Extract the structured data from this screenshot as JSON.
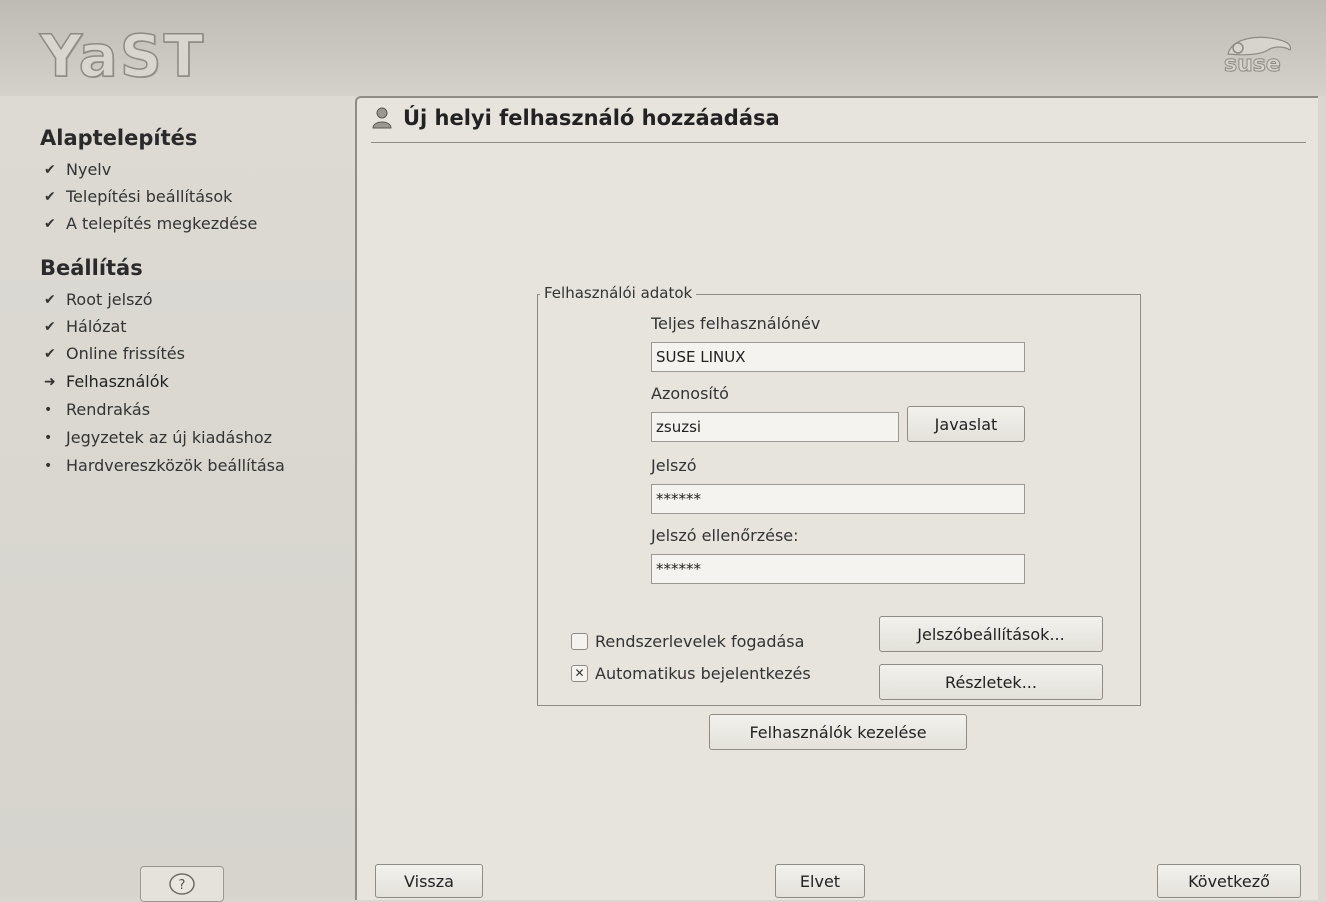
{
  "header": {
    "logo_text": "YaST",
    "brand_text": "suse"
  },
  "sidebar": {
    "sections": [
      {
        "title": "Alaptelepítés",
        "items": [
          {
            "status": "done",
            "label": "Nyelv"
          },
          {
            "status": "done",
            "label": "Telepítési beállítások"
          },
          {
            "status": "done",
            "label": "A telepítés megkezdése"
          }
        ]
      },
      {
        "title": "Beállítás",
        "items": [
          {
            "status": "done",
            "label": "Root jelszó"
          },
          {
            "status": "done",
            "label": "Hálózat"
          },
          {
            "status": "done",
            "label": "Online frissítés"
          },
          {
            "status": "current",
            "label": "Felhasználók"
          },
          {
            "status": "pending",
            "label": "Rendrakás"
          },
          {
            "status": "pending",
            "label": "Jegyzetek az új kiadáshoz"
          },
          {
            "status": "pending",
            "label": "Hardvereszközök beállítása"
          }
        ]
      }
    ],
    "marks": {
      "done": "✔",
      "current": "➜",
      "pending": "•"
    },
    "help_icon": "help-icon"
  },
  "main": {
    "title": "Új helyi felhasználó hozzáadása",
    "title_icon": "user-icon",
    "group_title": "Felhasználói adatok",
    "fields": {
      "full_name_label": "Teljes felhasználónév",
      "full_name_value": "SUSE LINUX",
      "username_label": "Azonosító",
      "username_value": "zsuzsi",
      "password_label": "Jelszó",
      "password_value": "******",
      "confirm_label": "Jelszó ellenőrzése:",
      "confirm_value": "******"
    },
    "buttons": {
      "suggest": "Javaslat",
      "password_settings": "Jelszóbeállítások...",
      "details": "Részletek...",
      "manage_users": "Felhasználók kezelése"
    },
    "checkboxes": [
      {
        "label": "Rendszerlevelek fogadása",
        "checked": false
      },
      {
        "label": "Automatikus bejelentkezés",
        "checked": true
      }
    ]
  },
  "footer": {
    "back": "Vissza",
    "abort": "Elvet",
    "next": "Következő"
  }
}
